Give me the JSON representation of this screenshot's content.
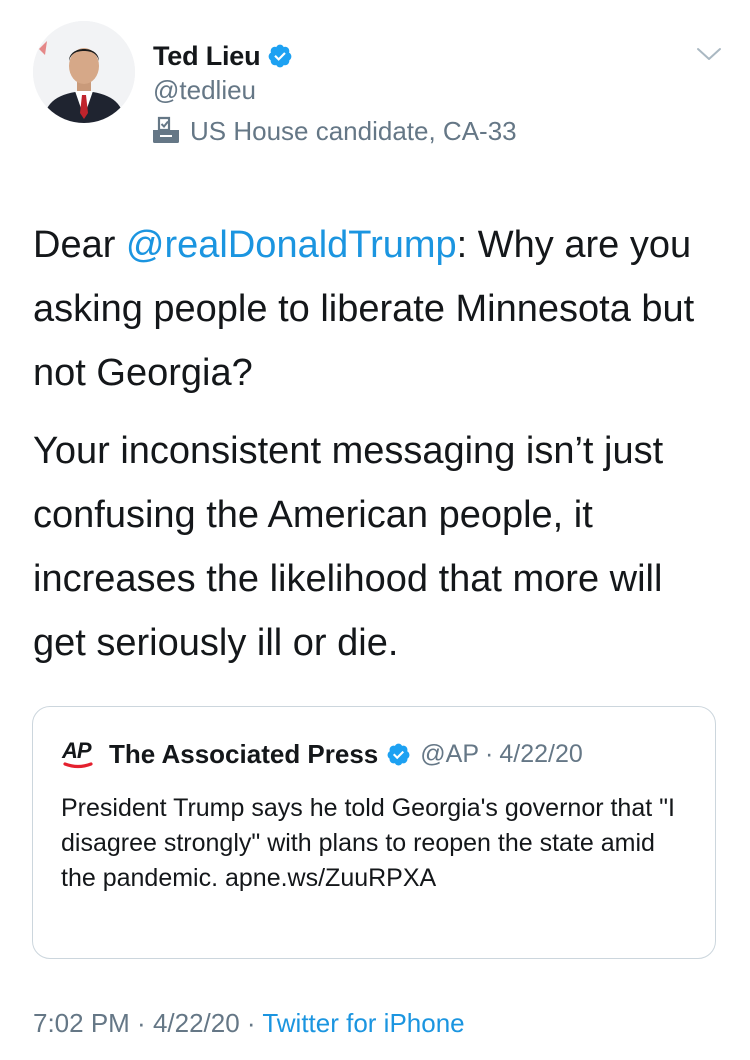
{
  "author": {
    "name": "Ted Lieu",
    "handle": "@tedlieu",
    "label": "US House candidate, CA-33",
    "label_icon": "ballot-box-icon",
    "verified_icon": "verified-badge-icon"
  },
  "tweet": {
    "line1_prefix": "Dear ",
    "mention": "@realDonaldTrump",
    "line1_suffix": ": Why are you asking people to liberate Minnesota but not Georgia?",
    "paragraph2": "Your inconsistent messaging isn’t just confusing the American people, it increases the likelihood that more will get seriously ill or die."
  },
  "quote": {
    "logo_text": "AP",
    "name": "The Associated Press",
    "handle": "@AP",
    "separator": "·",
    "date": "4/22/20",
    "text": "President Trump says he told Georgia's governor that \"I disagree strongly\" with plans to reopen the state amid the pandemic. apne.ws/ZuuRPXA"
  },
  "footer": {
    "time": "7:02 PM",
    "sep1": " · ",
    "date": "4/22/20",
    "sep2": " · ",
    "source": "Twitter for iPhone"
  },
  "colors": {
    "link": "#1b95e0",
    "verified": "#1da1f2",
    "secondary": "#657786",
    "border": "#ccd6dd",
    "ap_red": "#e4202e"
  }
}
